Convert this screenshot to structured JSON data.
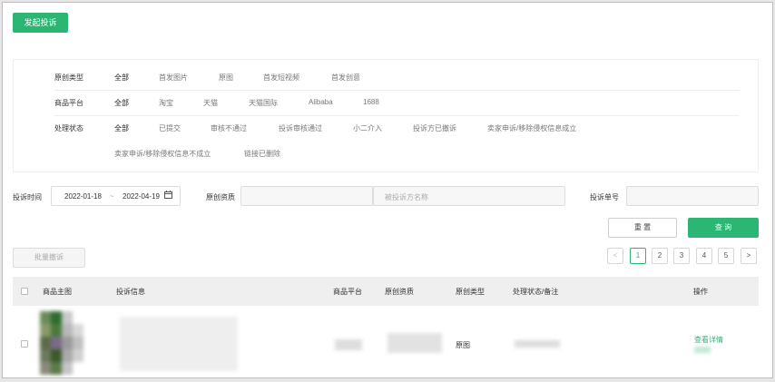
{
  "toolbar": {
    "launch_label": "发起投诉"
  },
  "filters": {
    "type": {
      "label": "原创类型",
      "options": [
        "全部",
        "首发图片",
        "原图",
        "首发短视频",
        "首发创意"
      ]
    },
    "platform": {
      "label": "商品平台",
      "options": [
        "全部",
        "淘宝",
        "天猫",
        "天猫国际",
        "Alibaba",
        "1688"
      ]
    },
    "status": {
      "label": "处理状态",
      "options": [
        "全部",
        "已提交",
        "审核不通过",
        "投诉审核通过",
        "小二介入",
        "投诉方已撤诉",
        "卖家申诉/移除侵权信息成立",
        "卖家申诉/移除侵权信息不成立",
        "链接已删除"
      ]
    }
  },
  "search": {
    "time_label": "投诉时间",
    "date_from": "2022-01-18",
    "date_sep": "~",
    "date_to": "2022-04-19",
    "source_label": "原创资质",
    "party_placeholder": "被投诉方名称",
    "number_label": "投诉单号",
    "reset_label": "重 置",
    "query_label": "查 询"
  },
  "bulk": {
    "withdraw_label": "批量撤诉"
  },
  "pagination": {
    "prev": "<",
    "pages": [
      "1",
      "2",
      "3",
      "4",
      "5"
    ],
    "current": "1",
    "next": ">"
  },
  "table": {
    "headers": [
      "商品主图",
      "投诉信息",
      "商品平台",
      "原创资质",
      "原创类型",
      "处理状态/备注",
      "操作"
    ],
    "rows": [
      {
        "type": "原图",
        "action": "查看详情"
      }
    ]
  },
  "colors": {
    "accent": "#2bb673",
    "header_bg": "#efefef"
  }
}
